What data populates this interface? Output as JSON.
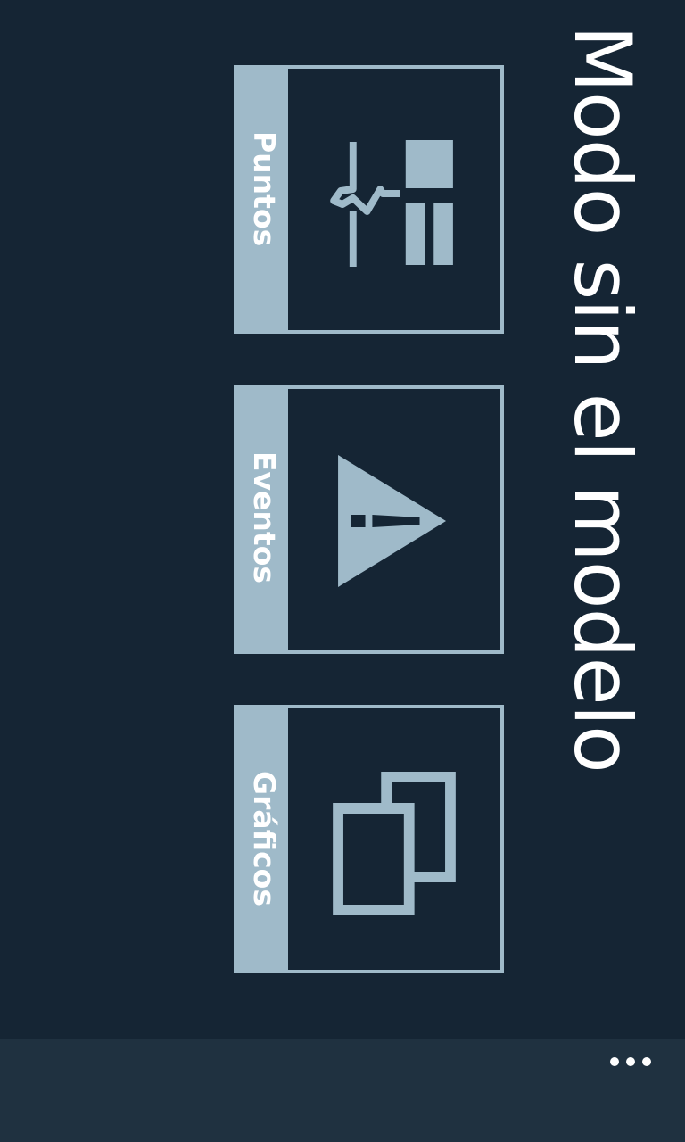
{
  "page": {
    "title": "Modo sin el modelo"
  },
  "tiles": [
    {
      "label": "Puntos",
      "icon": "points-waveform-icon"
    },
    {
      "label": "Eventos",
      "icon": "warning-triangle-icon"
    },
    {
      "label": "Gráficos",
      "icon": "overlapping-windows-icon"
    }
  ],
  "appbar": {
    "more_icon": "more-ellipsis-icon"
  },
  "colors": {
    "background": "#152534",
    "accent": "#9fbac9",
    "appbar": "#1f3140",
    "text": "#ffffff"
  }
}
